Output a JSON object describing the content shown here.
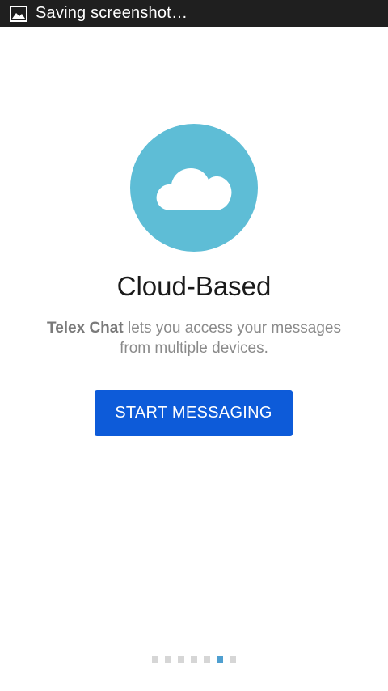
{
  "status_bar": {
    "text": "Saving screenshot…",
    "icon": "image-icon"
  },
  "intro": {
    "icon": "cloud-icon",
    "circle_color": "#5ebdd6",
    "title": "Cloud-Based",
    "description_brand": "Telex Chat",
    "description_line1_rest": " lets you access your messages",
    "description_line2": "from multiple devices.",
    "button_label": "START MESSAGING",
    "button_color": "#0d5bd9"
  },
  "pager": {
    "total": 7,
    "active_index": 5,
    "active_color": "#4f9fd0",
    "inactive_color": "#d6d6d6"
  }
}
